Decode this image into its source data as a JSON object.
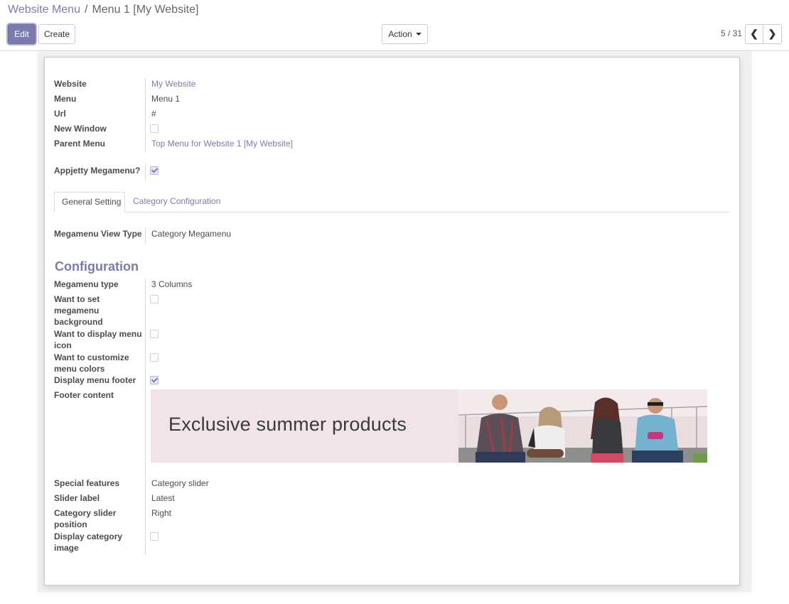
{
  "breadcrumb": {
    "parent": "Website Menu",
    "separator": "/",
    "current": "Menu 1 [My Website]"
  },
  "toolbar": {
    "edit_label": "Edit",
    "create_label": "Create",
    "action_label": "Action"
  },
  "pager": {
    "value": "5 / 31",
    "prev": "❮",
    "next": "❯"
  },
  "fields": {
    "website": {
      "label": "Website",
      "value": "My Website"
    },
    "menu": {
      "label": "Menu",
      "value": "Menu 1"
    },
    "url": {
      "label": "Url",
      "value": "#"
    },
    "new_window": {
      "label": "New Window",
      "checked": false
    },
    "parent_menu": {
      "label": "Parent Menu",
      "value": "Top Menu for Website 1 [My Website]"
    },
    "appjetty_megamenu": {
      "label": "Appjetty Megamenu?",
      "checked": true
    }
  },
  "tabs": [
    {
      "label": "General Setting",
      "active": true
    },
    {
      "label": "Category Configuration",
      "active": false
    }
  ],
  "general": {
    "view_type": {
      "label": "Megamenu View Type",
      "value": "Category Megamenu"
    }
  },
  "configuration": {
    "title": "Configuration",
    "megamenu_type": {
      "label": "Megamenu type",
      "value": "3 Columns"
    },
    "set_background": {
      "label_lines": [
        "Want to set",
        "megamenu",
        "background"
      ],
      "checked": false
    },
    "display_icon": {
      "label_lines": [
        "Want to display menu",
        "icon"
      ],
      "checked": false
    },
    "customize_colors": {
      "label_lines": [
        "Want to customize",
        "menu colors"
      ],
      "checked": false
    },
    "display_footer": {
      "label": "Display menu footer",
      "checked": true
    },
    "footer_content": {
      "label": "Footer content",
      "banner_text": "Exclusive summer products"
    },
    "special_features": {
      "label": "Special features",
      "value": "Category slider"
    },
    "slider_label": {
      "label": "Slider label",
      "value": "Latest"
    },
    "slider_position": {
      "label_lines": [
        "Category slider",
        "position"
      ],
      "value": "Right"
    },
    "display_category_image": {
      "label_lines": [
        "Display category",
        "image"
      ],
      "checked": false
    }
  },
  "colors": {
    "accent": "#7c7bad",
    "banner_bg": "#f1e4e9"
  }
}
